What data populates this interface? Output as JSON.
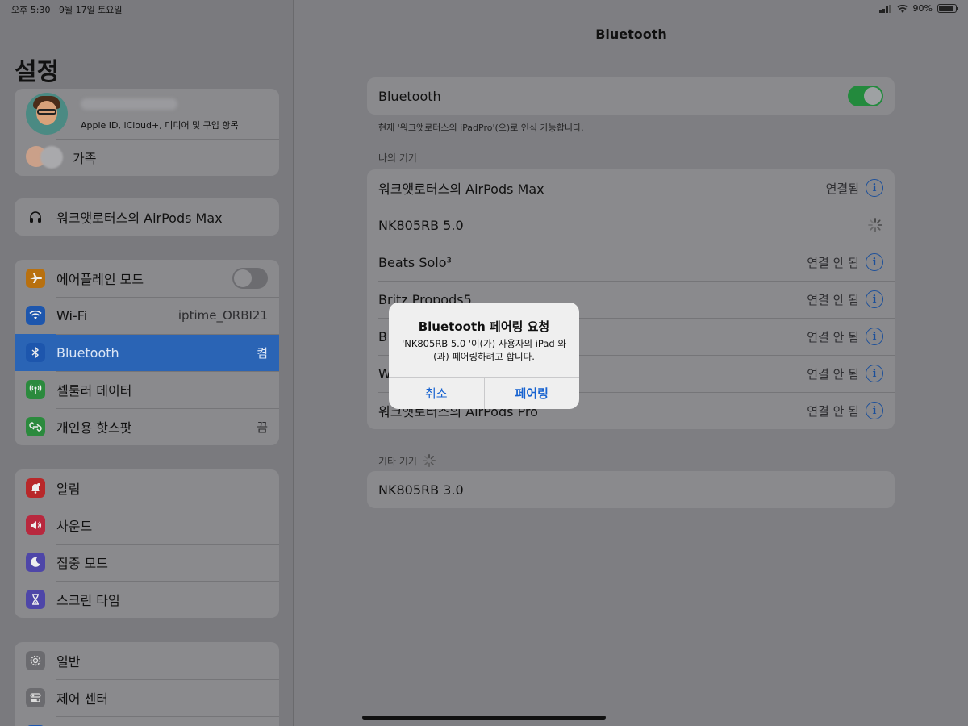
{
  "status_bar": {
    "time": "오후 5:30",
    "date": "9월 17일 토요일",
    "battery": "90%",
    "battery_level": 0.9
  },
  "sidebar": {
    "title": "설정",
    "profile": {
      "subtitle": "Apple ID, iCloud+, 미디어 및 구입 항목"
    },
    "family": {
      "label": "가족"
    },
    "airpods": {
      "label": "워크앳로터스의 AirPods Max"
    },
    "network": [
      {
        "label": "에어플레인 모드",
        "icon": "airplane-icon",
        "color": "#b8700f"
      },
      {
        "label": "Wi-Fi",
        "value": "iptime_ORBI21",
        "icon": "wifi-icon",
        "color": "#1d56ad"
      },
      {
        "label": "Bluetooth",
        "value": "켬",
        "icon": "bluetooth-icon",
        "color": "#1d56ad"
      },
      {
        "label": "셀룰러 데이터",
        "icon": "antenna-icon",
        "color": "#2b8a3d"
      },
      {
        "label": "개인용 핫스팟",
        "value": "끔",
        "icon": "hotspot-icon",
        "color": "#2b8a3d"
      }
    ],
    "notifications": [
      {
        "label": "알림",
        "icon": "bell-icon",
        "color": "#b8282a"
      },
      {
        "label": "사운드",
        "icon": "speaker-icon",
        "color": "#b8283e"
      },
      {
        "label": "집중 모드",
        "icon": "moon-icon",
        "color": "#4e46a8"
      },
      {
        "label": "스크린 타임",
        "icon": "hourglass-icon",
        "color": "#4e46a8"
      }
    ],
    "general": [
      {
        "label": "일반",
        "icon": "gear-icon",
        "color": "#6b6b6f"
      },
      {
        "label": "제어 센터",
        "icon": "switches-icon",
        "color": "#6b6b6f"
      }
    ]
  },
  "main": {
    "title": "Bluetooth",
    "bluetooth_toggle_label": "Bluetooth",
    "bluetooth_on": true,
    "discoverable_note": "현재 '워크앳로터스의 iPadPro'(으)로 인식 가능합니다.",
    "my_devices_header": "나의 기기",
    "my_devices": [
      {
        "name": "워크앳로터스의 AirPods Max",
        "status": "연결됨"
      },
      {
        "name": "NK805RB 5.0",
        "status": ""
      },
      {
        "name": "Beats Solo³",
        "status": "연결 안 됨"
      },
      {
        "name": "Britz Propods5",
        "status": "연결 안 됨"
      },
      {
        "name": "B",
        "status": "연결 안 됨"
      },
      {
        "name": "W",
        "status": "연결 안 됨"
      },
      {
        "name": "워크앳로터스의 AirPods Pro",
        "status": "연결 안 됨"
      }
    ],
    "other_devices_header": "기타 기기",
    "other_devices": [
      {
        "name": "NK805RB 3.0"
      }
    ]
  },
  "alert": {
    "title": "Bluetooth 페어링 요청",
    "message": "'NK805RB 5.0 '이(가) 사용자의 iPad 와(과) 페어링하려고 합니다.",
    "cancel": "취소",
    "confirm": "페어링"
  }
}
